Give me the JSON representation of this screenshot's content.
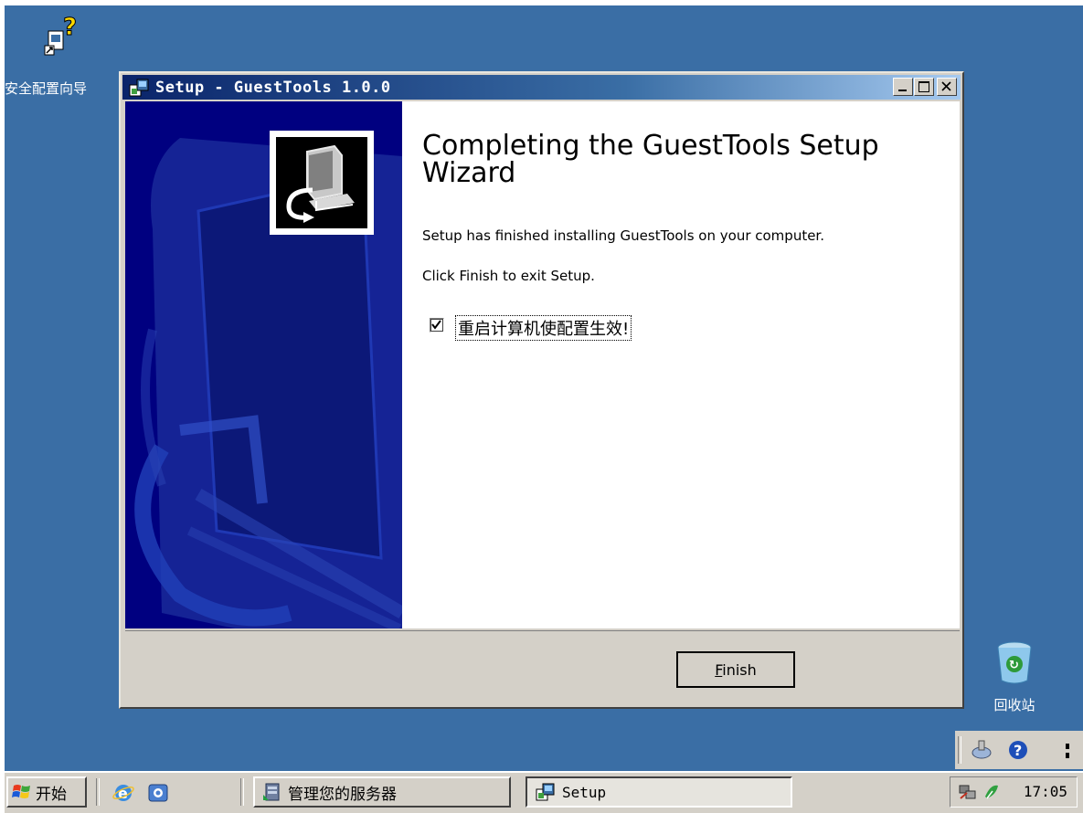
{
  "desktop": {
    "icons": [
      {
        "label": "安全配置向导",
        "icon": "security-wizard-icon"
      },
      {
        "label": "回收站",
        "icon": "recycle-bin-icon"
      }
    ]
  },
  "window": {
    "title": "Setup - GuestTools 1.0.0",
    "controls": [
      "minimize",
      "maximize",
      "close"
    ],
    "heading": "Completing the GuestTools Setup Wizard",
    "message1": "Setup has finished installing GuestTools on your computer.",
    "message2": "Click Finish to exit Setup.",
    "checkbox": {
      "label": "重启计算机使配置生效!",
      "checked": true
    },
    "finish_button": {
      "mnemonic": "F",
      "rest": "inish"
    }
  },
  "taskbar": {
    "start_label": "开始",
    "tasks": [
      {
        "label": "管理您的服务器",
        "icon": "server-manage-icon"
      },
      {
        "label": "Setup",
        "icon": "setup-icon"
      }
    ],
    "clock": "17:05"
  },
  "colors": {
    "desktop": "#3a6ea5",
    "titlebar_start": "#0a246a",
    "sidebar": "#000080",
    "face": "#d4d0c8"
  }
}
